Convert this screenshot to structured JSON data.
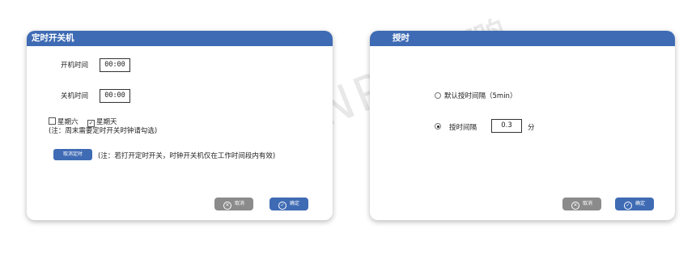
{
  "timer_dialog": {
    "title": "定时开关机",
    "power_on_label": "开机时间",
    "power_on_value": "00:00",
    "power_off_label": "关机时间",
    "power_off_value": "00:00",
    "saturday_label": "星期六",
    "sunday_label": "星期天",
    "weekend_note": "(注：周末需要定时开关时钟请勾选)",
    "cancel_timer_label": "取消定时",
    "timer_note": "(注：若打开定时开关，时钟开关机仅在工作时间段内有效)",
    "cancel_label": "取消",
    "ok_label": "确定"
  },
  "time_dialog": {
    "title": "授时",
    "default_interval_label": "默认授时间隔（5min）",
    "interval_label": "授时间隔",
    "interval_value": "0.3",
    "unit_label": "分",
    "cancel_label": "取消",
    "ok_label": "确定"
  },
  "watermark": "SUNPN讯鹏"
}
